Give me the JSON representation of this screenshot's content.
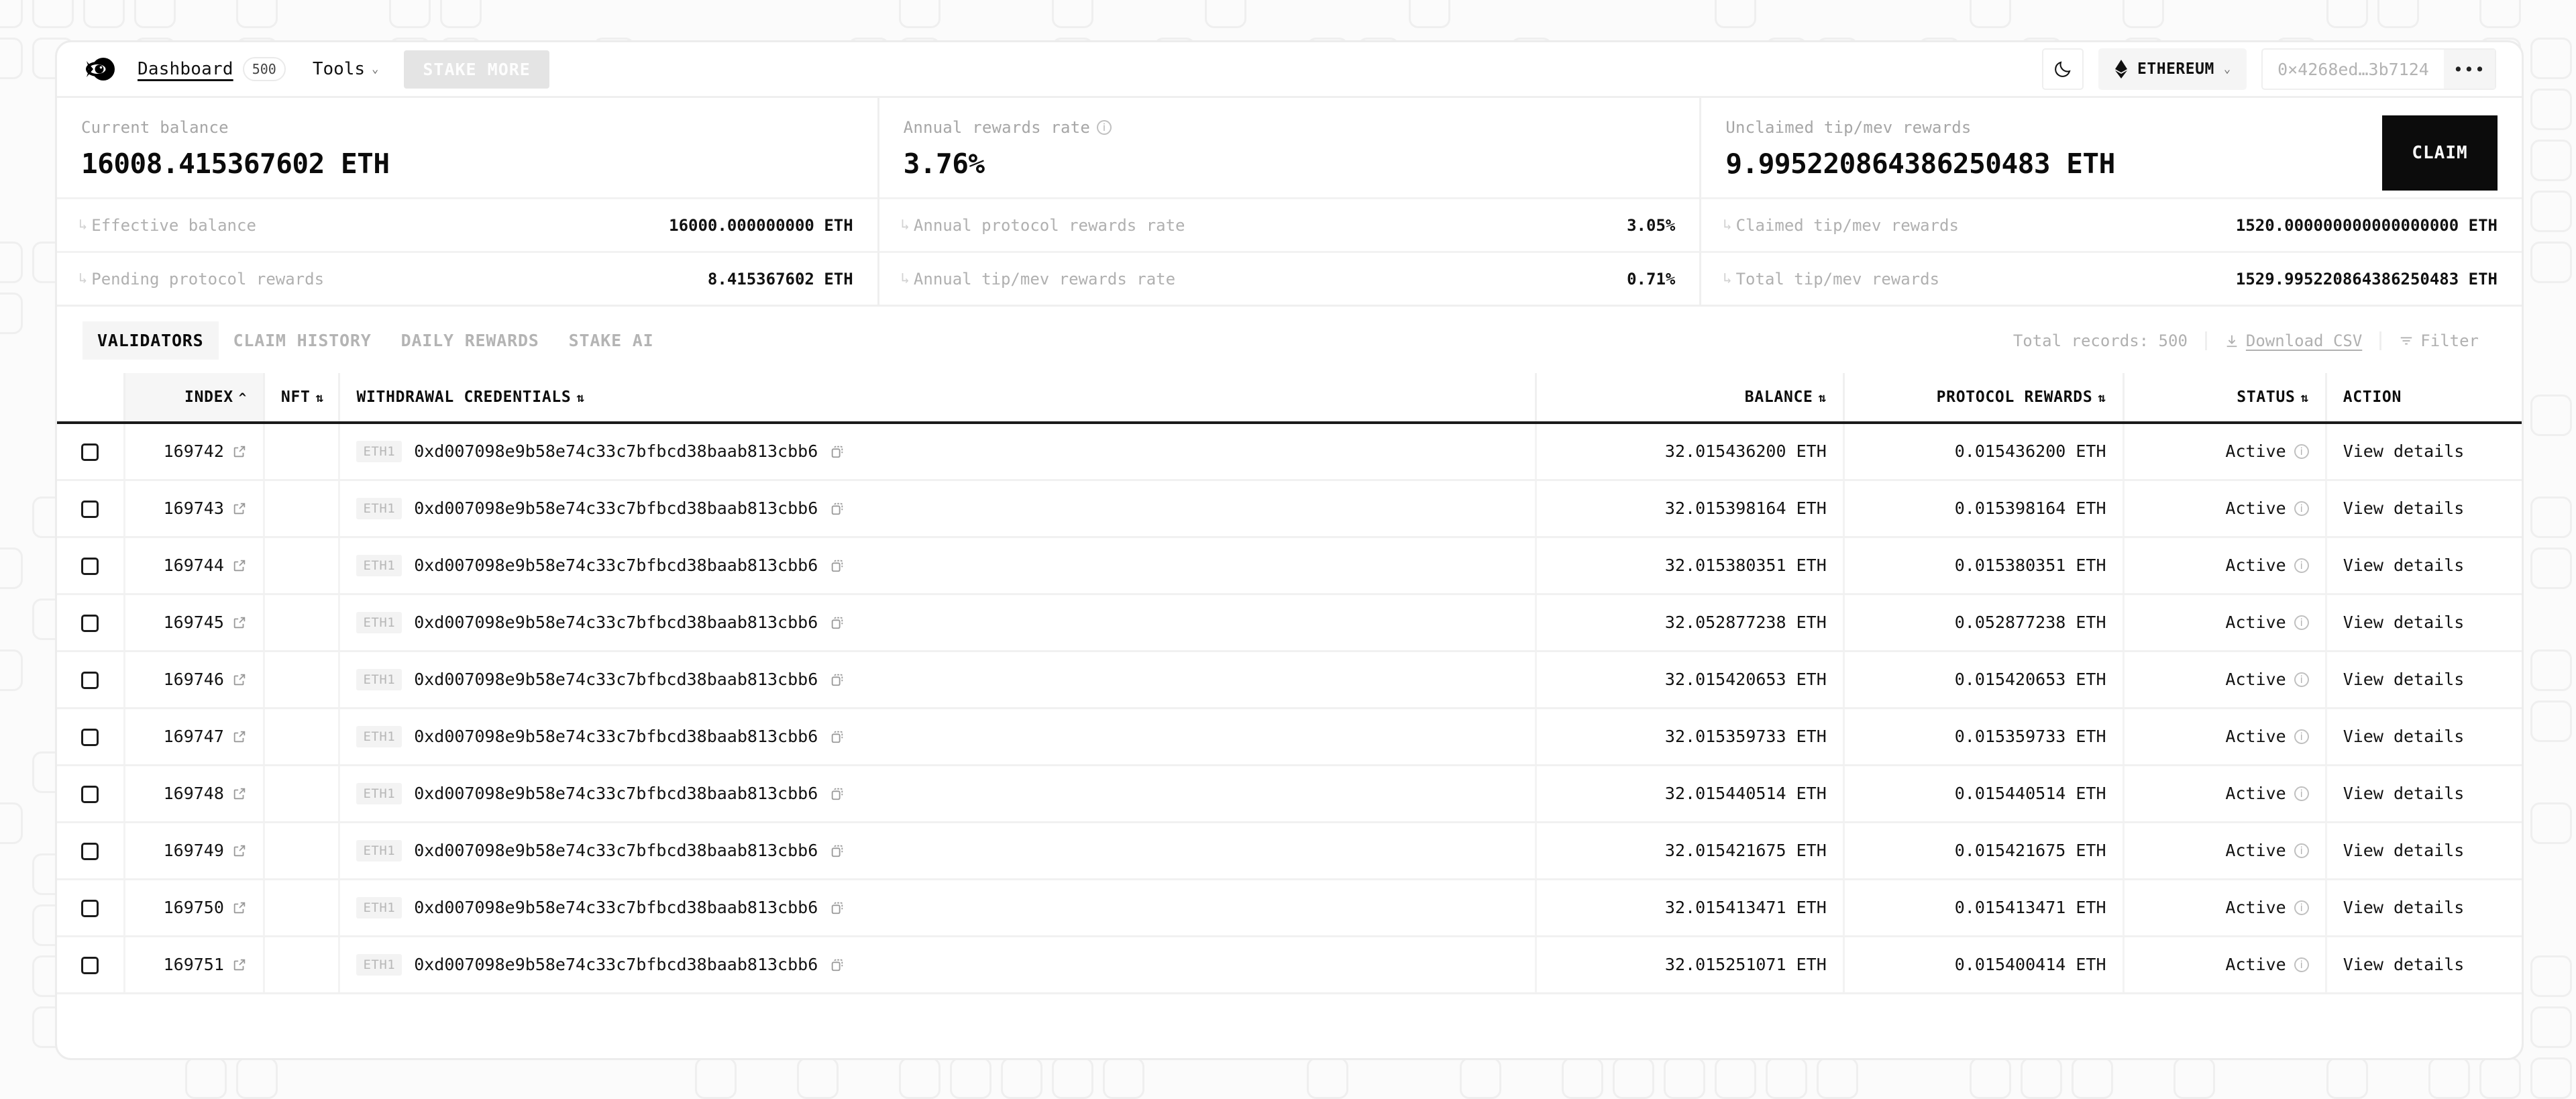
{
  "nav": {
    "logo_name": "fish-eye-logo",
    "dashboard_label": "Dashboard",
    "dashboard_badge": "500",
    "tools_label": "Tools",
    "stake_more_label": "STAKE MORE",
    "theme_icon": "moon-icon",
    "network_icon": "ethereum-diamond-icon",
    "network_label": "ETHEREUM",
    "wallet_address": "0×4268ed…3b7124",
    "wallet_more_label": "•••"
  },
  "stats": [
    {
      "label": "Current balance",
      "value": "16008.415367602 ETH",
      "has_info": false,
      "subs": [
        {
          "label": "Effective balance",
          "value": "16000.000000000 ETH"
        },
        {
          "label": "Pending protocol rewards",
          "value": "8.415367602 ETH"
        }
      ]
    },
    {
      "label": "Annual rewards rate",
      "value": "3.76%",
      "has_info": true,
      "subs": [
        {
          "label": "Annual protocol rewards rate",
          "value": "3.05%"
        },
        {
          "label": "Annual tip/mev rewards rate",
          "value": "0.71%"
        }
      ]
    },
    {
      "label": "Unclaimed tip/mev rewards",
      "value": "9.995220864386250483 ETH",
      "has_info": false,
      "claim_label": "CLAIM",
      "subs": [
        {
          "label": "Claimed tip/mev rewards",
          "value": "1520.000000000000000000 ETH"
        },
        {
          "label": "Total tip/mev rewards",
          "value": "1529.995220864386250483 ETH"
        }
      ]
    }
  ],
  "tabs": [
    {
      "label": "VALIDATORS",
      "active": true
    },
    {
      "label": "CLAIM HISTORY",
      "active": false
    },
    {
      "label": "DAILY REWARDS",
      "active": false
    },
    {
      "label": "STAKE AI",
      "active": false
    }
  ],
  "table_actions": {
    "total_records": "Total records: 500",
    "download_label": "Download CSV",
    "download_icon": "download-icon",
    "filter_label": "Filter",
    "filter_icon": "filter-icon"
  },
  "table": {
    "columns": [
      {
        "key": "check",
        "label": "",
        "sort": "none"
      },
      {
        "key": "index",
        "label": "INDEX",
        "sort": "asc"
      },
      {
        "key": "nft",
        "label": "NFT",
        "sort": "both"
      },
      {
        "key": "cred",
        "label": "WITHDRAWAL CREDENTIALS",
        "sort": "both"
      },
      {
        "key": "balance",
        "label": "BALANCE",
        "sort": "both"
      },
      {
        "key": "rewards",
        "label": "PROTOCOL REWARDS",
        "sort": "both"
      },
      {
        "key": "status",
        "label": "STATUS",
        "sort": "both"
      },
      {
        "key": "action",
        "label": "ACTION",
        "sort": "none"
      }
    ],
    "credential_badge": "ETH1",
    "credential_address": "0xd007098e9b58e74c33c7bfbcd38baab813cbb6",
    "action_label": "View details",
    "status_label": "Active",
    "rows": [
      {
        "index": "169742",
        "balance": "32.015436200 ETH",
        "rewards": "0.015436200 ETH",
        "status": "Active"
      },
      {
        "index": "169743",
        "balance": "32.015398164 ETH",
        "rewards": "0.015398164 ETH",
        "status": "Active"
      },
      {
        "index": "169744",
        "balance": "32.015380351 ETH",
        "rewards": "0.015380351 ETH",
        "status": "Active"
      },
      {
        "index": "169745",
        "balance": "32.052877238 ETH",
        "rewards": "0.052877238 ETH",
        "status": "Active"
      },
      {
        "index": "169746",
        "balance": "32.015420653 ETH",
        "rewards": "0.015420653 ETH",
        "status": "Active"
      },
      {
        "index": "169747",
        "balance": "32.015359733 ETH",
        "rewards": "0.015359733 ETH",
        "status": "Active"
      },
      {
        "index": "169748",
        "balance": "32.015440514 ETH",
        "rewards": "0.015440514 ETH",
        "status": "Active"
      },
      {
        "index": "169749",
        "balance": "32.015421675 ETH",
        "rewards": "0.015421675 ETH",
        "status": "Active"
      },
      {
        "index": "169750",
        "balance": "32.015413471 ETH",
        "rewards": "0.015413471 ETH",
        "status": "Active"
      },
      {
        "index": "169751",
        "balance": "32.015251071 ETH",
        "rewards": "0.015400414 ETH",
        "status": "Active"
      }
    ]
  },
  "colors": {
    "accent": "#0c0c0c",
    "page_bg": "#fbfbfb",
    "card_bg": "#ffffff",
    "muted_text": "#b0b0b0",
    "border": "#efefef"
  }
}
